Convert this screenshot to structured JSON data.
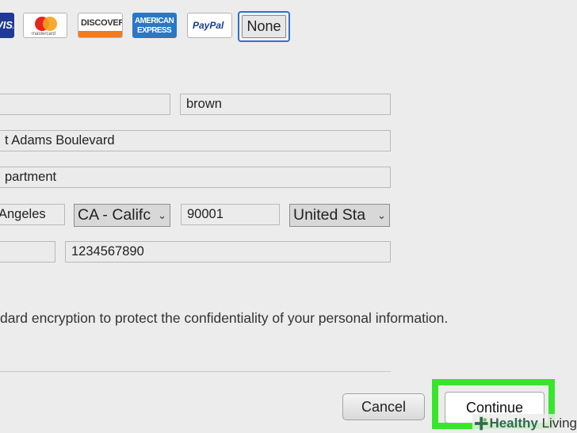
{
  "payment_methods": {
    "visa_label": "VISA",
    "mastercard_label": "mastercard",
    "discover_label": "DISCOVER",
    "amex_line1": "AMERICAN",
    "amex_line2": "EXPRESS",
    "paypal_label": "PayPal",
    "none_label": "None"
  },
  "form": {
    "first_name": "",
    "last_name": "brown",
    "address1": "t Adams Boulevard",
    "address2": "partment",
    "city": "Angeles",
    "state": "CA - Califc",
    "zip": "90001",
    "country": "United Sta",
    "phone_prefix": "",
    "phone": "1234567890"
  },
  "info_text": "dard encryption to protect the confidentiality of your personal information.",
  "buttons": {
    "cancel": "Cancel",
    "continue": "Continue"
  },
  "watermark": {
    "bold": "Healthy",
    "rest": " Living"
  },
  "colors": {
    "highlight": "#39e52c",
    "selected_border": "#2f6fd1"
  }
}
